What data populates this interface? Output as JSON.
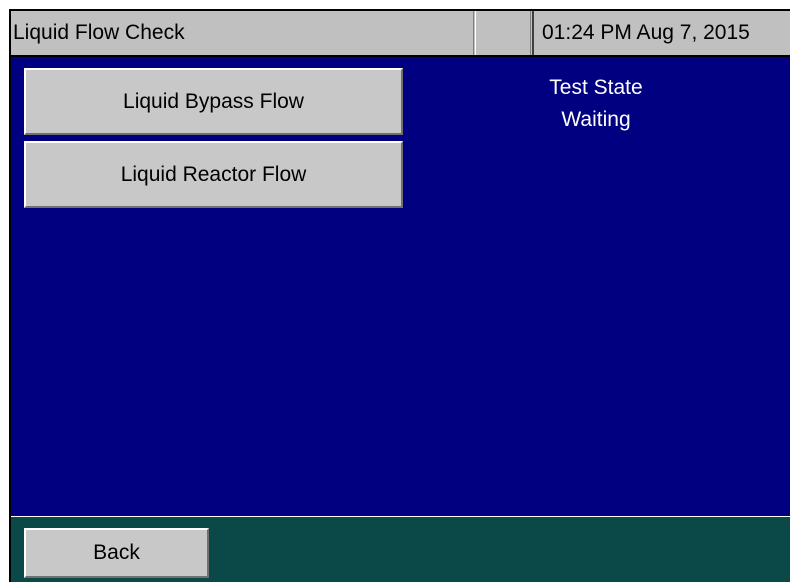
{
  "header": {
    "title": "Liquid Flow Check",
    "blank": "",
    "clock": "01:24 PM Aug 7, 2015"
  },
  "buttons": {
    "bypass_label": "Liquid Bypass Flow",
    "reactor_label": "Liquid Reactor Flow",
    "back_label": "Back"
  },
  "status": {
    "label": "Test State",
    "value": "Waiting"
  },
  "colors": {
    "panel_background": "#000080",
    "footer_background": "#0b4848",
    "button_face": "#c8c8c8",
    "titlebar": "#c0c0c0",
    "status_text": "#ffffff"
  }
}
